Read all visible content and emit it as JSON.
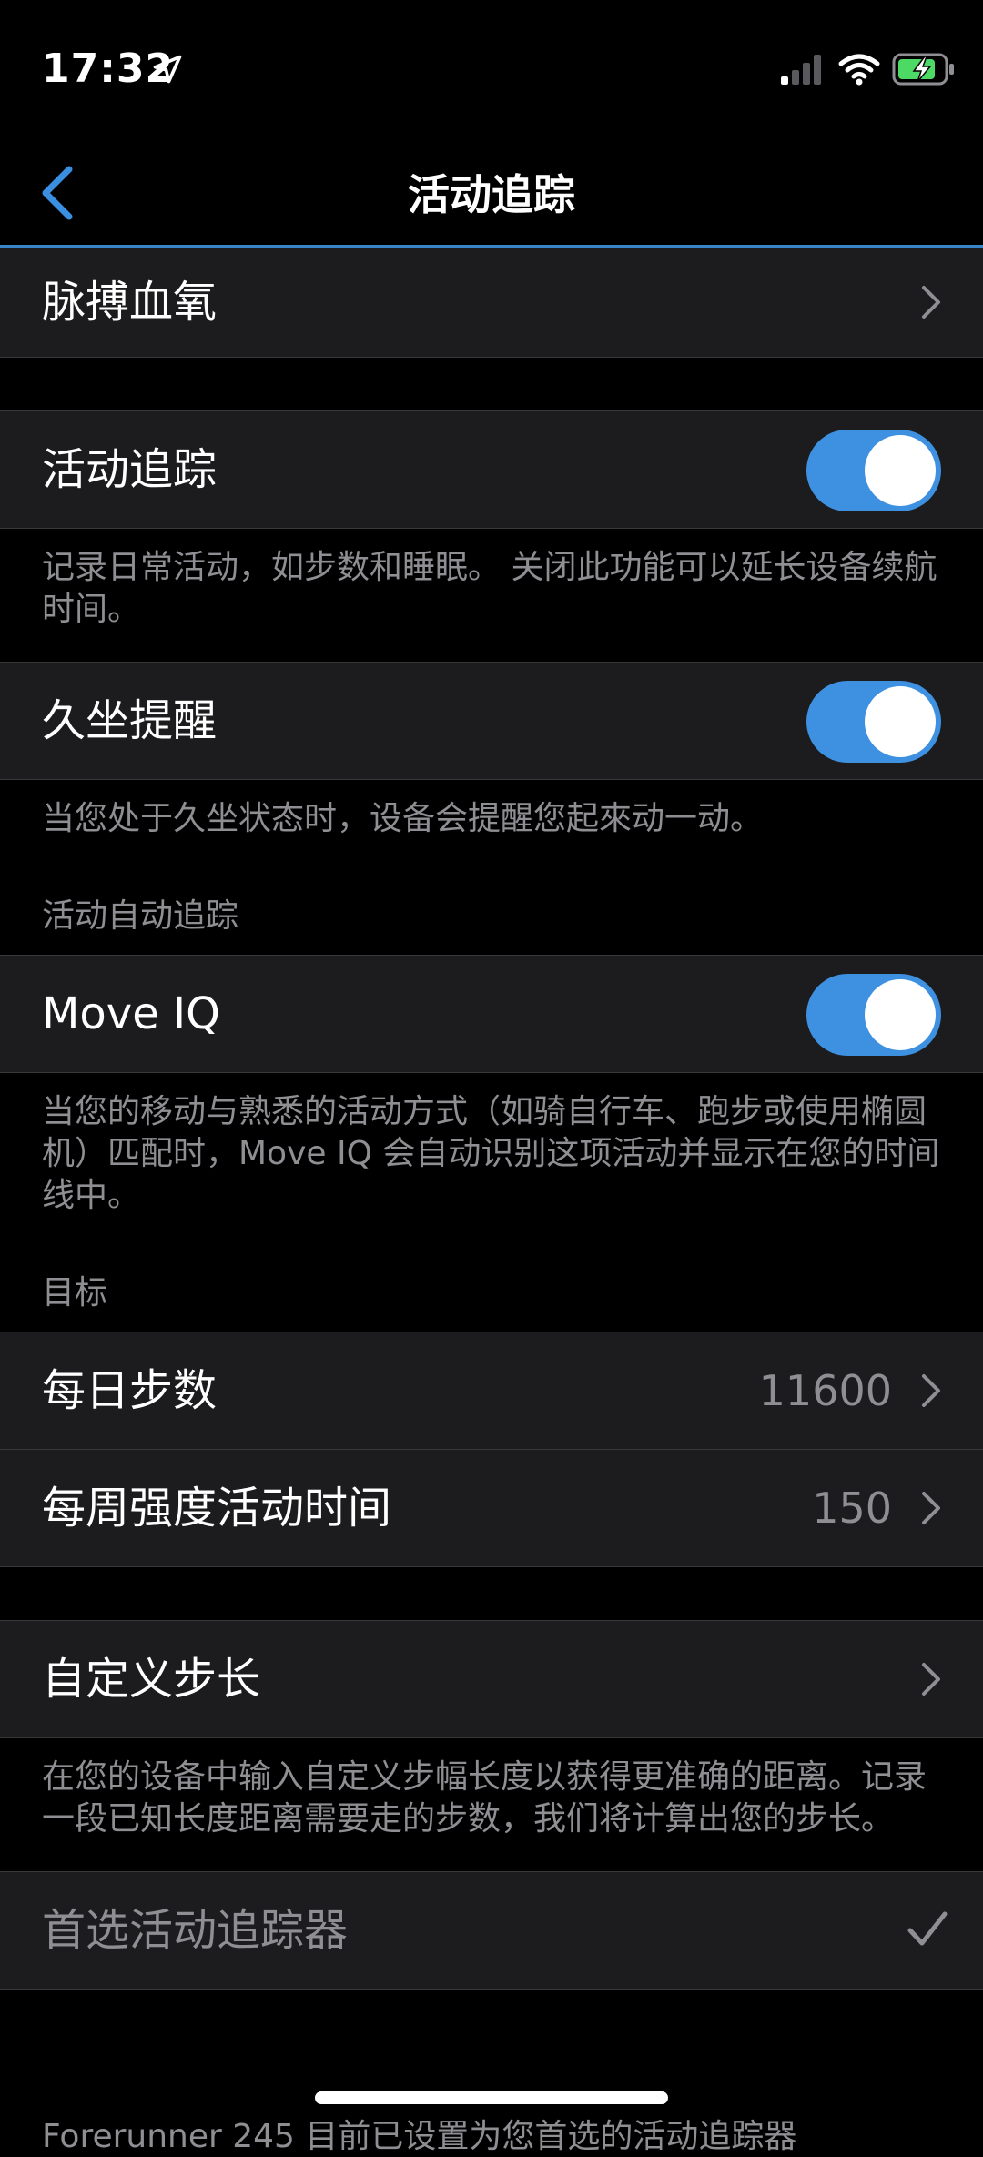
{
  "status_bar": {
    "time": "17:32"
  },
  "nav": {
    "title": "活动追踪",
    "back_icon": "chevron-left-icon"
  },
  "rows": {
    "pulse_ox": "脉搏血氧",
    "activity_tracking": {
      "label": "活动追踪",
      "enabled": true,
      "footer": "记录日常活动，如步数和睡眠。 关闭此功能可以延长设备续航时间。"
    },
    "move_alert": {
      "label": "久坐提醒",
      "enabled": true,
      "footer": "当您处于久坐状态时，设备会提醒您起來动一动。"
    },
    "auto_section_header": "活动自动追踪",
    "move_iq": {
      "label": "Move IQ",
      "enabled": true,
      "footer": "当您的移动与熟悉的活动方式（如骑自行车、跑步或使用椭圆机）匹配时，Move IQ 会自动识别这项活动并显示在您的时间线中。"
    },
    "goals_header": "目标",
    "daily_steps": {
      "label": "每日步数",
      "value": "11600"
    },
    "weekly_intensity": {
      "label": "每周强度活动时间",
      "value": "150"
    },
    "custom_stride": {
      "label": "自定义步长",
      "footer": "在您的设备中输入自定义步幅长度以获得更准确的距离。记录一段已知长度距离需要走的步数，我们将计算出您的步长。"
    },
    "preferred_tracker": {
      "label": "首选活动追踪器",
      "checked": true
    },
    "cut_footer": "Forerunner 245 目前已设置为您首选的活动追踪器"
  }
}
